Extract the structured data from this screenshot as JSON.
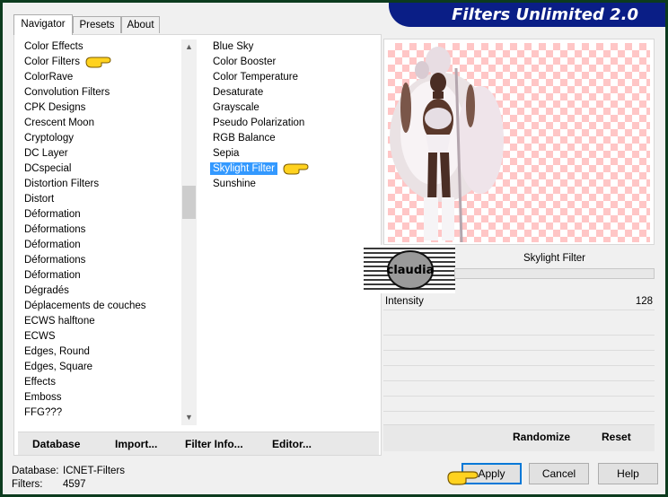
{
  "brand": {
    "title": "Filters Unlimited 2.0"
  },
  "tabs": [
    {
      "label": "Navigator"
    },
    {
      "label": "Presets"
    },
    {
      "label": "About"
    }
  ],
  "categories": [
    "Color Effects",
    "Color Filters",
    "ColorRave",
    "Convolution Filters",
    "CPK Designs",
    "Crescent Moon",
    "Cryptology",
    "DC Layer",
    "DCspecial",
    "Distortion Filters",
    "Distort",
    "Déformation",
    "Déformations",
    "Déformation",
    "Déformations",
    "Déformation",
    "Dégradés",
    "Déplacements de couches",
    "ECWS halftone",
    "ECWS",
    "Edges, Round",
    "Edges, Square",
    "Effects",
    "Emboss",
    "FFG???"
  ],
  "filters": [
    "Blue Sky",
    "Color Booster",
    "Color Temperature",
    "Desaturate",
    "Grayscale",
    "Pseudo Polarization",
    "RGB Balance",
    "Sepia",
    "Skylight Filter",
    "Sunshine"
  ],
  "selected_category": "Color Filters",
  "selected_filter": "Skylight Filter",
  "list_buttons": {
    "database": "Database",
    "import": "Import...",
    "filter_info": "Filter Info...",
    "editor": "Editor..."
  },
  "logo": {
    "text": "claudia"
  },
  "preview": {
    "filter_name": "Skylight Filter"
  },
  "controls": [
    {
      "name": "Intensity",
      "value": "128"
    }
  ],
  "right_buttons": {
    "randomize": "Randomize",
    "reset": "Reset"
  },
  "status": {
    "database_label": "Database:",
    "database_value": "ICNET-Filters",
    "filters_label": "Filters:",
    "filters_value": "4597"
  },
  "dialog_buttons": {
    "apply": "Apply",
    "cancel": "Cancel",
    "help": "Help"
  },
  "colors": {
    "selection": "#3399ff",
    "brand_bg": "#0a1e86",
    "checker": "#ffc6c6",
    "hand": "#ffd21f"
  }
}
